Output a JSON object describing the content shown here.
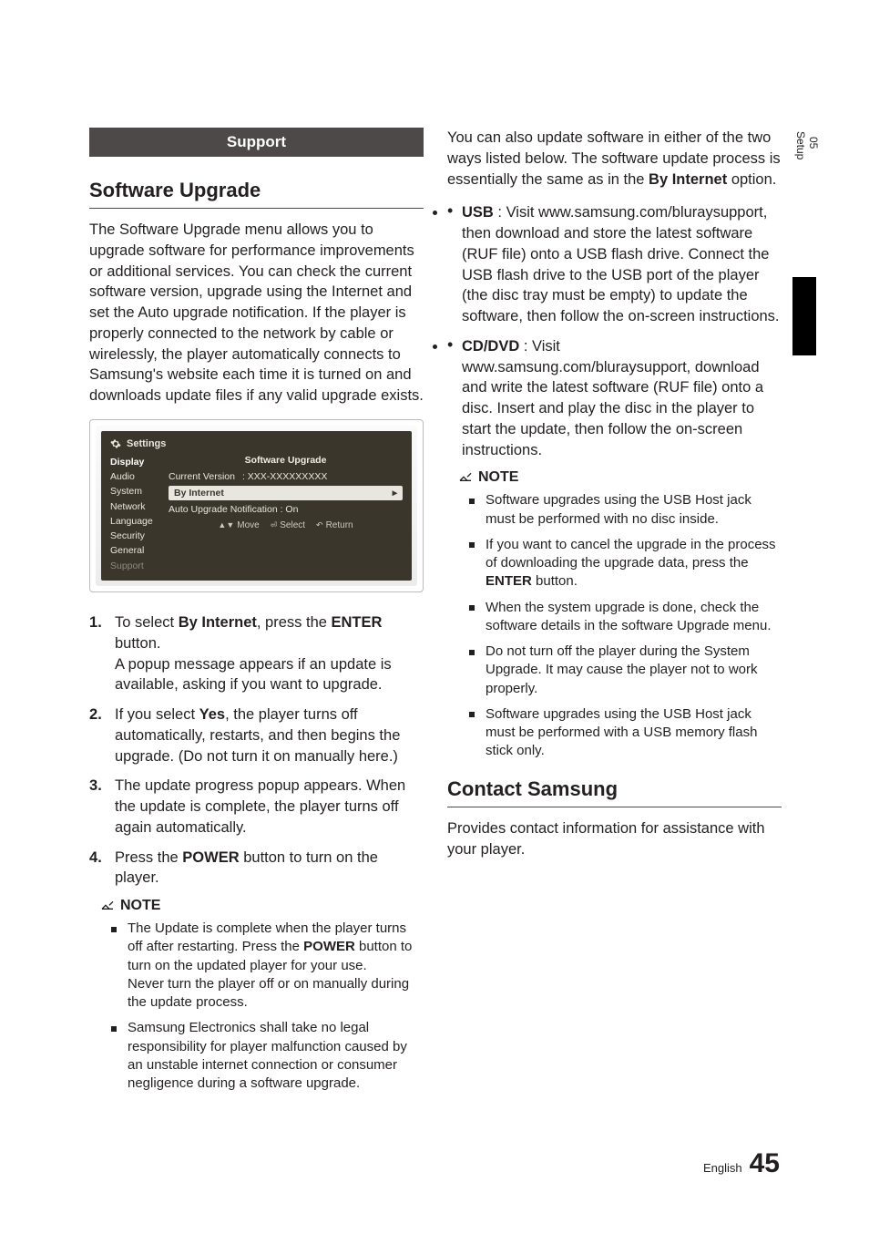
{
  "sideTab": {
    "chapterNum": "05",
    "chapterTitle": "Setup"
  },
  "banner": "Support",
  "h_software": "Software Upgrade",
  "p_intro": "The Software Upgrade menu allows you to upgrade software for performance improvements or additional services. You can check the current software version, upgrade using the Internet and set the Auto upgrade notification. If the player is properly connected to the network by cable or wirelessly, the player automatically connects to Samsung's website each time it is turned on and downloads update files if any valid upgrade exists.",
  "settings": {
    "title": "Settings",
    "nav": [
      "Display",
      "Audio",
      "System",
      "Network",
      "Language",
      "Security",
      "General",
      "Support"
    ],
    "panelTitle": "Software Upgrade",
    "currentVersionLabel": "Current Version",
    "currentVersionValue": ": XXX-XXXXXXXXX",
    "byInternet": "By Internet",
    "autoNotif": "Auto Upgrade Notification  : On",
    "help": {
      "move": "Move",
      "select": "Select",
      "return": "Return"
    }
  },
  "steps": {
    "s1a": "To select ",
    "s1b": "By Internet",
    "s1c": ", press the ",
    "s1d": "ENTER",
    "s1e": " button.",
    "s1sub": "A popup message appears if an update is available, asking if you want to upgrade.",
    "s2a": "If you select ",
    "s2b": "Yes",
    "s2c": ", the player turns off automatically, restarts, and then begins the upgrade. (Do not turn it on manually here.)",
    "s3": "The update progress popup appears. When the update is complete, the player turns off again automatically.",
    "s4a": "Press the ",
    "s4b": "POWER",
    "s4c": " button to turn on the player."
  },
  "noteLabel": "NOTE",
  "notes1": {
    "n1a": "The Update is complete when the player turns off after restarting. Press the ",
    "n1b": "POWER",
    "n1c": " button to turn on the updated player for your use.",
    "n1d": "Never turn the player off or on manually during the update process.",
    "n2": "Samsung Electronics shall take no legal responsibility for player malfunction caused by an unstable internet connection or consumer negligence during a software upgrade."
  },
  "col2": {
    "p_also_a": "You can also update software in either of the two ways listed below. The software update process is essentially the same as in the ",
    "p_also_b": "By Internet",
    "p_also_c": " option.",
    "usb_label": "USB",
    "usb_text": " : Visit www.samsung.com/bluraysupport, then download and store the latest software (RUF file) onto a USB flash drive. Connect the USB flash drive to the USB port of the player (the disc tray must be empty) to update the software, then follow the on-screen instructions.",
    "cd_label": "CD/DVD",
    "cd_text": " : Visit www.samsung.com/bluraysupport, download and write the latest software (RUF file) onto a disc. Insert and play the disc in the player to start the update, then follow the on-screen instructions.",
    "notes": {
      "n1": "Software upgrades using the USB Host jack must be performed with no disc inside.",
      "n2a": "If you want to cancel the upgrade in the process of downloading the upgrade data, press the ",
      "n2b": "ENTER",
      "n2c": " button.",
      "n3": "When the system upgrade is done, check the software details in the software Upgrade menu.",
      "n4": "Do not turn off the player during the System Upgrade. It may cause the player not to work properly.",
      "n5": "Software upgrades using the USB Host jack must be performed with a USB memory flash stick only."
    }
  },
  "h_contact": "Contact Samsung",
  "p_contact": "Provides contact information for assistance with your player.",
  "footer": {
    "lang": "English",
    "page": "45"
  }
}
